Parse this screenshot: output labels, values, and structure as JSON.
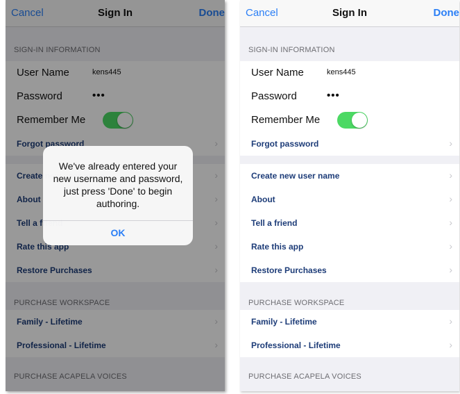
{
  "nav": {
    "cancel": "Cancel",
    "title": "Sign In",
    "done": "Done"
  },
  "sections": {
    "signin": "SIGN-IN INFORMATION",
    "workspace": "PURCHASE WORKSPACE",
    "voices": "PURCHASE ACAPELA VOICES"
  },
  "signin": {
    "username_label": "User Name",
    "username_value": "kens445",
    "password_label": "Password",
    "password_value": "•••",
    "remember_label": "Remember Me",
    "remember_on": true,
    "forgot": "Forgot password"
  },
  "links": {
    "create": "Create new user name",
    "about": "About",
    "tell": "Tell a friend",
    "rate": "Rate this app",
    "restore": "Restore Purchases"
  },
  "workspace": {
    "family": "Family - Lifetime",
    "professional": "Professional - Lifetime"
  },
  "chevron": "›",
  "alert": {
    "message": "We've already entered your new username and password, just press 'Done' to begin authoring.",
    "ok": "OK"
  },
  "colors": {
    "accent": "#2b7ff6",
    "toggle_on": "#4cd964",
    "link_text": "#1d3c78"
  }
}
